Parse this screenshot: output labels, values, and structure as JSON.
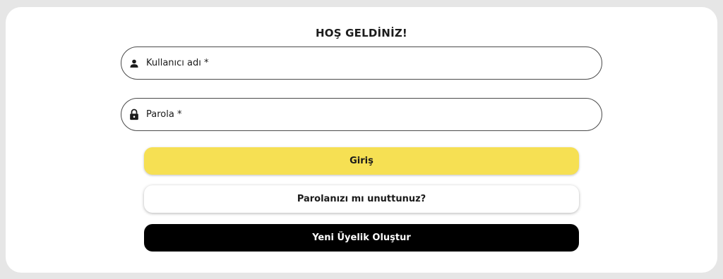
{
  "form": {
    "title": "HOŞ GELDİNİZ!",
    "username": {
      "label": "Kullanıcı adı *",
      "icon": "person-icon"
    },
    "password": {
      "label": "Parola *",
      "icon": "lock-icon"
    }
  },
  "buttons": {
    "login_label": "Giriş",
    "forgot_label": "Parolanızı mı unuttunuz?",
    "register_label": "Yeni Üyelik Oluştur"
  },
  "colors": {
    "accent": "#f6e053",
    "register_bg": "#000000",
    "page_bg": "#e6e6e6"
  }
}
